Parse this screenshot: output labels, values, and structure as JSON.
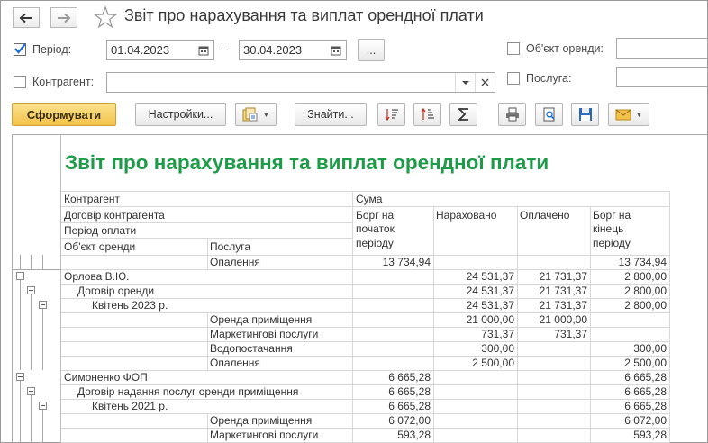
{
  "window": {
    "title": "Звіт про нарахування та виплат орендної плати"
  },
  "filters": {
    "period": {
      "label": "Період:",
      "checked": true,
      "from": "01.04.2023",
      "dash": "–",
      "to": "30.04.2023",
      "more_label": "..."
    },
    "counterparty": {
      "label": "Контрагент:",
      "value": ""
    },
    "lease_object": {
      "label": "Об'єкт оренди:",
      "value": ""
    },
    "service": {
      "label": "Послуга:",
      "value": ""
    }
  },
  "toolbar": {
    "generate_label": "Сформувати",
    "settings_label": "Настройки...",
    "find_label": "Знайти..."
  },
  "report": {
    "title": "Звіт про нарахування та виплат орендної плати",
    "headers": {
      "counterparty": "Контрагент",
      "contract": "Договір контрагента",
      "period": "Період оплати",
      "object": "Об'єкт оренди",
      "service": "Послуга",
      "sum": "Сума",
      "debt_start_1": "Борг на",
      "debt_start_2": "початок",
      "debt_start_3": "періоду",
      "accrued": "Нараховано",
      "paid": "Оплачено",
      "debt_end_1": "Борг на",
      "debt_end_2": "кінець",
      "debt_end_3": "періоду"
    },
    "rows": [
      {
        "label": "Опалення",
        "indent": "service",
        "start": "13 734,94",
        "accrued": "",
        "paid": "",
        "end": "13 734,94"
      },
      {
        "label": "Орлова В.Ю.",
        "indent": "l0",
        "start": "",
        "accrued": "24 531,37",
        "paid": "21 731,37",
        "end": "2 800,00"
      },
      {
        "label": "Договір оренди",
        "indent": "l1",
        "start": "",
        "accrued": "24 531,37",
        "paid": "21 731,37",
        "end": "2 800,00"
      },
      {
        "label": "Квітень 2023 р.",
        "indent": "l2",
        "start": "",
        "accrued": "24 531,37",
        "paid": "21 731,37",
        "end": "2 800,00"
      },
      {
        "label": "Оренда приміщення",
        "indent": "service",
        "start": "",
        "accrued": "21 000,00",
        "paid": "21 000,00",
        "end": ""
      },
      {
        "label": "Маркетингові послуги",
        "indent": "service",
        "start": "",
        "accrued": "731,37",
        "paid": "731,37",
        "end": ""
      },
      {
        "label": "Водопостачання",
        "indent": "service",
        "start": "",
        "accrued": "300,00",
        "paid": "",
        "end": "300,00"
      },
      {
        "label": "Опалення",
        "indent": "service",
        "start": "",
        "accrued": "2 500,00",
        "paid": "",
        "end": "2 500,00"
      },
      {
        "label": "Симоненко ФОП",
        "indent": "l0",
        "start": "6 665,28",
        "accrued": "",
        "paid": "",
        "end": "6 665,28"
      },
      {
        "label": "Договір надання послуг оренди приміщення",
        "indent": "l1",
        "start": "6 665,28",
        "accrued": "",
        "paid": "",
        "end": "6 665,28"
      },
      {
        "label": "Квітень 2021 р.",
        "indent": "l2",
        "start": "6 665,28",
        "accrued": "",
        "paid": "",
        "end": "6 665,28"
      },
      {
        "label": "Оренда приміщення",
        "indent": "service",
        "start": "6 072,00",
        "accrued": "",
        "paid": "",
        "end": "6 072,00"
      },
      {
        "label": "Маркетингові послуги",
        "indent": "service",
        "start": "593,28",
        "accrued": "",
        "paid": "",
        "end": "593,28"
      }
    ]
  },
  "colors": {
    "accent_title": "#1e9b48",
    "primary_button": "#f3c24a"
  },
  "icons": [
    "back-arrow-icon",
    "forward-arrow-icon",
    "star-icon",
    "calendar-icon",
    "dropdown-icon",
    "clear-icon",
    "variants-icon",
    "sort-desc-icon",
    "sort-asc-icon",
    "sum-icon",
    "print-icon",
    "preview-icon",
    "save-icon",
    "email-icon"
  ]
}
